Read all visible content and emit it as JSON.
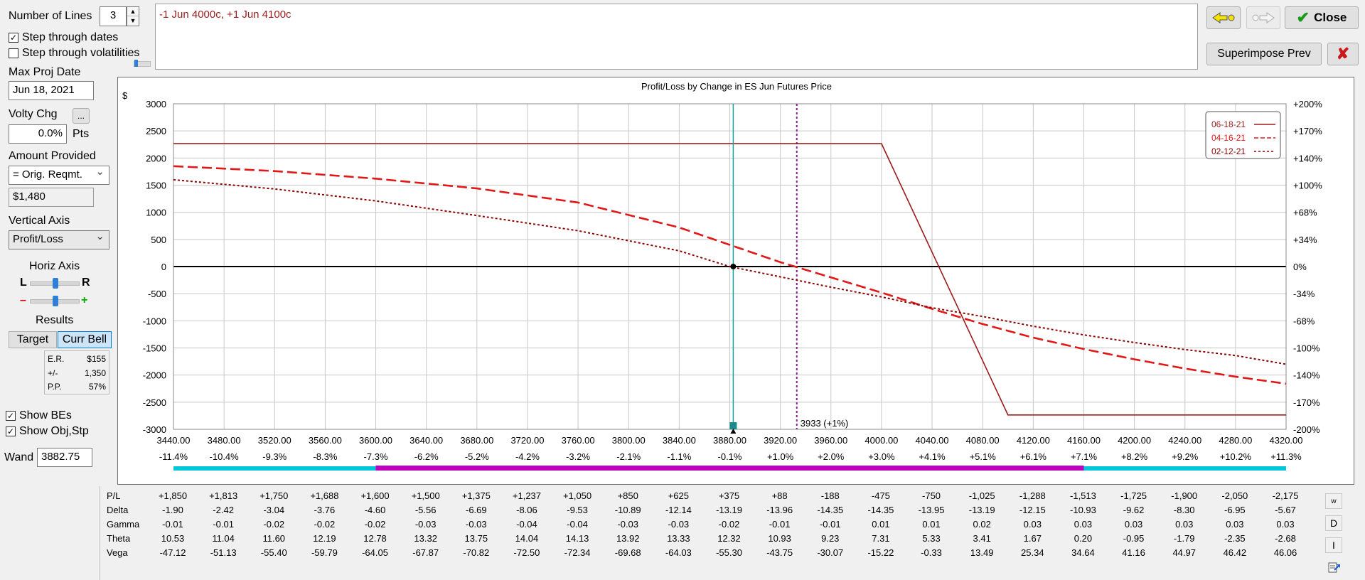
{
  "controls": {
    "num_lines_label": "Number of Lines",
    "num_lines_value": "3",
    "step_dates_label": "Step through dates",
    "step_vol_label": "Step through volatilities",
    "max_proj_label": "Max Proj Date",
    "max_proj_value": "Jun 18, 2021",
    "volty_label": "Volty Chg",
    "volty_btn": "...",
    "volty_value": "0.0%",
    "volty_unit": "Pts",
    "amount_label": "Amount Provided",
    "amount_select": "= Orig. Reqmt.",
    "amount_value": "$1,480",
    "vert_axis_label": "Vertical Axis",
    "vert_axis_value": "Profit/Loss",
    "horiz_axis_label": "Horiz Axis",
    "horiz_l": "L",
    "horiz_r": "R",
    "zoom_minus": "–",
    "zoom_plus": "+",
    "results_label": "Results",
    "target_btn": "Target",
    "curr_bell_btn": "Curr Bell",
    "er_label": "E.R.",
    "er_value": "$155",
    "pm_label": "+/-",
    "pm_value": "1,350",
    "pp_label": "P.P.",
    "pp_value": "57%",
    "show_bes_label": "Show BEs",
    "show_obj_label": "Show Obj,Stp",
    "wand_label": "Wand",
    "wand_value": "3882.75"
  },
  "position_text": "-1 Jun 4000c, +1 Jun 4100c",
  "buttons": {
    "close": "Close",
    "superimpose": "Superimpose Prev",
    "back_arrow_icon": "yellow-left-arrow-icon",
    "fwd_arrow_icon": "gray-right-arrow-icon"
  },
  "colors": {
    "expiry_line": "#9b1c1c",
    "mid_line": "#e01818",
    "current_line": "#8b0000",
    "wand_line": "#1aa3a3",
    "target_line": "#8b1a9b",
    "cyan_bar": "#00c8d8",
    "magenta_bar": "#c000c0"
  },
  "chart_data": {
    "type": "line",
    "title": "Profit/Loss by Change in ES Jun Futures Price",
    "ylabel": "$",
    "ylim": [
      -3000,
      3000
    ],
    "xlim": [
      3440,
      4320
    ],
    "y_ticks": [
      "3000",
      "2500",
      "2000",
      "1500",
      "1000",
      "500",
      "0",
      "-500",
      "-1000",
      "-1500",
      "-2000",
      "-2500",
      "-3000"
    ],
    "right_ticks": [
      "+200%",
      "+170%",
      "+140%",
      "+100%",
      "+68%",
      "+34%",
      "0%",
      "-34%",
      "-68%",
      "-100%",
      "-140%",
      "-170%",
      "-200%"
    ],
    "x_ticks": [
      "3440.00",
      "3480.00",
      "3520.00",
      "3560.00",
      "3600.00",
      "3640.00",
      "3680.00",
      "3720.00",
      "3760.00",
      "3800.00",
      "3840.00",
      "3880.00",
      "3920.00",
      "3960.00",
      "4000.00",
      "4040.00",
      "4080.00",
      "4120.00",
      "4160.00",
      "4200.00",
      "4240.00",
      "4280.00",
      "4320.00"
    ],
    "x_pct": [
      "-11.4%",
      "-10.4%",
      "-9.3%",
      "-8.3%",
      "-7.3%",
      "-6.2%",
      "-5.2%",
      "-4.2%",
      "-3.2%",
      "-2.1%",
      "-1.1%",
      "-0.1%",
      "+1.0%",
      "+2.0%",
      "+3.0%",
      "+4.1%",
      "+5.1%",
      "+6.1%",
      "+7.1%",
      "+8.2%",
      "+9.2%",
      "+10.2%",
      "+11.3%"
    ],
    "legend": [
      "06-18-21",
      "04-16-21",
      "02-12-21"
    ],
    "legend_position": "top-right",
    "annotation": "3933 (+1%)",
    "wand_x": 3882.75,
    "target_x": 3933,
    "series": [
      {
        "name": "06-18-21",
        "style": "solid",
        "x": [
          3440,
          4000,
          4100,
          4320
        ],
        "y": [
          2265,
          2265,
          -2735,
          -2735
        ]
      },
      {
        "name": "04-16-21",
        "style": "dashed",
        "x": [
          3440,
          3520,
          3600,
          3680,
          3760,
          3840,
          3880,
          3920,
          3960,
          4000,
          4040,
          4080,
          4120,
          4160,
          4200,
          4240,
          4280,
          4320
        ],
        "y": [
          1850,
          1760,
          1620,
          1440,
          1180,
          720,
          400,
          80,
          -200,
          -480,
          -780,
          -1060,
          -1310,
          -1520,
          -1710,
          -1880,
          -2030,
          -2160
        ]
      },
      {
        "name": "02-12-21",
        "style": "dotted",
        "x": [
          3440,
          3520,
          3600,
          3680,
          3760,
          3840,
          3880,
          3920,
          3960,
          4000,
          4040,
          4080,
          4120,
          4160,
          4200,
          4240,
          4280,
          4320
        ],
        "y": [
          1600,
          1430,
          1210,
          940,
          660,
          290,
          0,
          -190,
          -380,
          -560,
          -760,
          -920,
          -1100,
          -1260,
          -1400,
          -1530,
          -1640,
          -1800
        ]
      }
    ],
    "bars": {
      "cyan": [
        3440,
        4320
      ],
      "magenta": [
        3600,
        4160
      ]
    }
  },
  "greeks": {
    "labels": [
      "P/L",
      "Delta",
      "Gamma",
      "Theta",
      "Vega"
    ],
    "rows": [
      [
        "+1,850",
        "+1,813",
        "+1,750",
        "+1,688",
        "+1,600",
        "+1,500",
        "+1,375",
        "+1,237",
        "+1,050",
        "+850",
        "+625",
        "+375",
        "+88",
        "-188",
        "-475",
        "-750",
        "-1,025",
        "-1,288",
        "-1,513",
        "-1,725",
        "-1,900",
        "-2,050",
        "-2,175"
      ],
      [
        "-1.90",
        "-2.42",
        "-3.04",
        "-3.76",
        "-4.60",
        "-5.56",
        "-6.69",
        "-8.06",
        "-9.53",
        "-10.89",
        "-12.14",
        "-13.19",
        "-13.96",
        "-14.35",
        "-14.35",
        "-13.95",
        "-13.19",
        "-12.15",
        "-10.93",
        "-9.62",
        "-8.30",
        "-6.95",
        "-5.67"
      ],
      [
        "-0.01",
        "-0.01",
        "-0.02",
        "-0.02",
        "-0.02",
        "-0.03",
        "-0.03",
        "-0.04",
        "-0.04",
        "-0.03",
        "-0.03",
        "-0.02",
        "-0.01",
        "-0.01",
        "0.01",
        "0.01",
        "0.02",
        "0.03",
        "0.03",
        "0.03",
        "0.03",
        "0.03",
        "0.03"
      ],
      [
        "10.53",
        "11.04",
        "11.60",
        "12.19",
        "12.78",
        "13.32",
        "13.75",
        "14.04",
        "14.13",
        "13.92",
        "13.33",
        "12.32",
        "10.93",
        "9.23",
        "7.31",
        "5.33",
        "3.41",
        "1.67",
        "0.20",
        "-0.95",
        "-1.79",
        "-2.35",
        "-2.68"
      ],
      [
        "-47.12",
        "-51.13",
        "-55.40",
        "-59.79",
        "-64.05",
        "-67.87",
        "-70.82",
        "-72.50",
        "-72.34",
        "-69.68",
        "-64.03",
        "-55.30",
        "-43.75",
        "-30.07",
        "-15.22",
        "-0.33",
        "13.49",
        "25.34",
        "34.64",
        "41.16",
        "44.97",
        "46.42",
        "46.06"
      ]
    ],
    "side_buttons": [
      "w",
      "D",
      "I"
    ]
  }
}
